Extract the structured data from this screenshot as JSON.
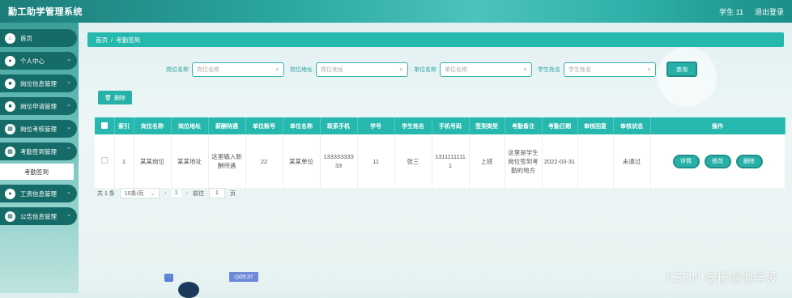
{
  "app": {
    "title": "勤工助学管理系统"
  },
  "topbar": {
    "user": "学生 11",
    "logout": "退出登录"
  },
  "sidebar": {
    "items": [
      {
        "label": "首页",
        "icon": "home-icon",
        "glyph": "⌂"
      },
      {
        "label": "个人中心",
        "icon": "user-icon",
        "glyph": "●"
      },
      {
        "label": "岗位信息管理",
        "icon": "doc-icon",
        "glyph": "■"
      },
      {
        "label": "岗位申请管理",
        "icon": "doc-icon",
        "glyph": "■"
      },
      {
        "label": "岗位考核管理",
        "icon": "grid-icon",
        "glyph": "▦"
      },
      {
        "label": "考勤签到管理",
        "icon": "grid-icon",
        "glyph": "▦"
      },
      {
        "label": "工资信息管理",
        "icon": "user-icon",
        "glyph": "●"
      },
      {
        "label": "公告信息管理",
        "icon": "grid-icon",
        "glyph": "▦"
      }
    ],
    "sub_item": "考勤签到"
  },
  "breadcrumb": {
    "home": "首页",
    "sep": "/",
    "current": "考勤签到"
  },
  "filters": [
    {
      "label": "岗位名称",
      "placeholder": "岗位名称"
    },
    {
      "label": "岗位地址",
      "placeholder": "岗位地址"
    },
    {
      "label": "单位名称",
      "placeholder": "单位名称"
    },
    {
      "label": "学生姓名",
      "placeholder": "学生姓名"
    }
  ],
  "search_button": "查询",
  "delete_button": "删除",
  "table": {
    "headers": [
      "",
      "索引",
      "岗位名称",
      "岗位地址",
      "薪酬待遇",
      "单位账号",
      "单位名称",
      "联系手机",
      "学号",
      "学生姓名",
      "手机号码",
      "签到类型",
      "考勤备注",
      "考勤日期",
      "审核回复",
      "审核状态",
      "操作"
    ],
    "row": {
      "index": "1",
      "post_name": "某某岗位",
      "post_address": "某某地址",
      "salary": "这里输入新酬待遇",
      "unit_account": "22",
      "unit_name": "某某单位",
      "contact_phone": "13333333333",
      "student_no": "11",
      "student_name": "张三",
      "mobile": "13111111111",
      "sign_type": "上班",
      "remark": "这里是学生岗位签到考勤的地方",
      "date": "2022-03-31",
      "review_reply": "",
      "review_status": "未通过",
      "actions": {
        "detail": "详情",
        "edit": "修改",
        "delete": "删除"
      }
    }
  },
  "pagination": {
    "total": "共 1 条",
    "page_size": "10条/页",
    "current_page": "1",
    "goto_label": "前往",
    "goto_value": "1",
    "page_suffix": "页"
  },
  "clock": "09:37",
  "watermark": "CSDN @粉泡泡毕设"
}
